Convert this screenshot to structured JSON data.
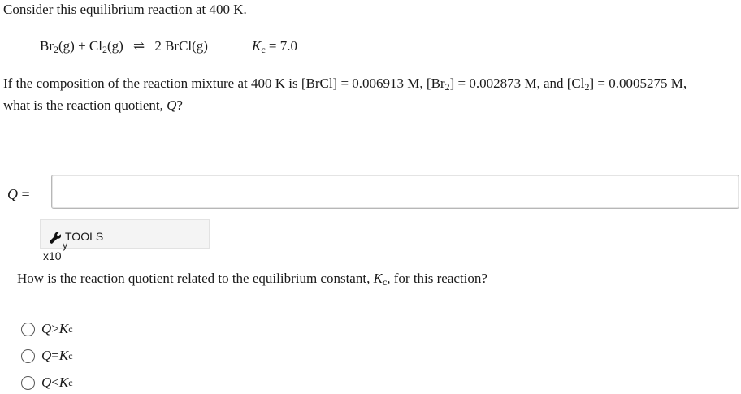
{
  "intro": "Consider this equilibrium reaction at 400 K.",
  "equation": {
    "br2": "Br",
    "br2_sub": "2",
    "br2_phase": "(g) + Cl",
    "cl2_sub": "2",
    "cl2_phase": "(g)",
    "arrow": "⇌",
    "product": "2 BrCl(g)"
  },
  "kc_line": {
    "k": "K",
    "c": "c",
    "value": " = 7.0"
  },
  "question": {
    "part1": "If the composition of the reaction mixture at 400 K is [BrCl] = 0.006913 M, [Br",
    "part1_sub": "2",
    "part2": "] = 0.002873 M, and [Cl",
    "part2_sub": "2",
    "part3": "] = 0.0005275 M,",
    "line2_pre": "what is the reaction quotient, ",
    "line2_q": "Q",
    "line2_post": "?"
  },
  "answer_label": {
    "q": "Q",
    "eq": " ="
  },
  "answer_value": "",
  "tools": {
    "label": "TOOLS",
    "y": "y",
    "x10": "x10",
    "icon": "wrench-icon"
  },
  "relation_question": {
    "pre": "How is the reaction quotient related to the equilibrium constant, ",
    "k": "K",
    "c": "c",
    "post": ", for this reaction?"
  },
  "options": [
    {
      "q": "Q",
      "op": " > ",
      "k": "K",
      "c": "c"
    },
    {
      "q": "Q",
      "op": " = ",
      "k": "K",
      "c": "c"
    },
    {
      "q": "Q",
      "op": " < ",
      "k": "K",
      "c": "c"
    }
  ]
}
